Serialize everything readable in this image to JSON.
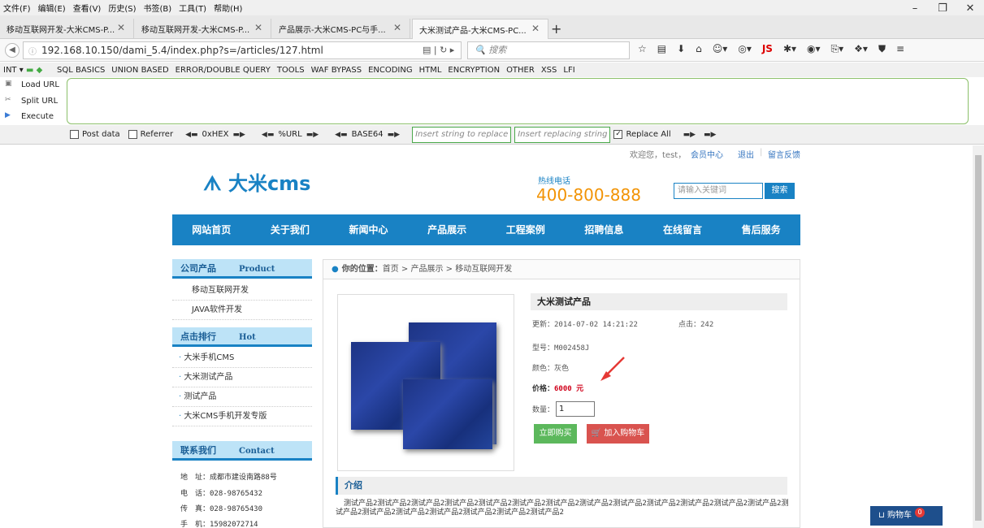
{
  "menubar": [
    "文件(F)",
    "编辑(E)",
    "查看(V)",
    "历史(S)",
    "书签(B)",
    "工具(T)",
    "帮助(H)"
  ],
  "tabs": [
    "移动互联网开发-大米CMS-P...",
    "移动互联网开发-大米CMS-P...",
    "产品展示-大米CMS-PC与手...",
    "大米测试产品-大米CMS-PC..."
  ],
  "url": "192.168.10.150/dami_5.4/index.php?s=/articles/127.html",
  "search_placeholder": "搜索",
  "hackbar": {
    "select": "INT",
    "menu": [
      "SQL BASICS",
      "UNION BASED",
      "ERROR/DOUBLE QUERY",
      "TOOLS",
      "WAF BYPASS",
      "ENCODING",
      "HTML",
      "ENCRYPTION",
      "OTHER",
      "XSS",
      "LFI"
    ],
    "load": "Load URL",
    "split": "Split URL",
    "execute": "Execute",
    "post": "Post data",
    "referrer": "Referrer",
    "hex": "0xHEX",
    "url": "%URL",
    "b64": "BASE64",
    "in1": "Insert string to replace",
    "in2": "Insert replacing string",
    "replace_all": "Replace All"
  },
  "site": {
    "welcome": "欢迎您，test，",
    "member": "会员中心",
    "logout": "退出",
    "feedback": "留言反馈",
    "logo": "大米cms",
    "hotline_label": "热线电话",
    "hotline": "400-800-888",
    "search_placeholder": "请输入关键词",
    "search_btn": "搜索",
    "nav": [
      "网站首页",
      "关于我们",
      "新闻中心",
      "产品展示",
      "工程案例",
      "招聘信息",
      "在线留言",
      "售后服务"
    ],
    "cat_title": "公司产品",
    "cat_en": "Product",
    "cats": [
      "移动互联网开发",
      "JAVA软件开发"
    ],
    "hot_title": "点击排行",
    "hot_en": "Hot",
    "hots": [
      "大米手机CMS",
      "大米测试产品",
      "测试产品",
      "大米CMS手机开发专版"
    ],
    "contact_title": "联系我们",
    "contact_en": "Contact",
    "contacts": [
      "地　址：成都市建设南路88号",
      "电　话：028-98765432",
      "传　真：028-98765430",
      "手　机：15982072714"
    ],
    "crumb_label": "你的位置：",
    "crumb": "首页 > 产品展示 > 移动互联网开发",
    "product": {
      "name": "大米测试产品",
      "updated": "更新：2014-07-02 14:21:22",
      "clicks": "点击：242",
      "model": "型号：M002458J",
      "color": "颜色：灰色",
      "price_label": "价格：",
      "price": "6000 元",
      "qty_label": "数量：",
      "qty": "1",
      "buy": "立即购买",
      "cart": "加入购物车"
    },
    "intro_title": "介绍",
    "intro": "测试产品2测试产品2测试产品2测试产品2测试产品2测试产品2测试产品2测试产品2测试产品2测试产品2测试产品2测试产品2测试产品2测试产品2测试产品2测试产品2测试产品2测试产品2测试产品2测试产品2",
    "cart_float": "购物车",
    "cart_count": "0"
  }
}
